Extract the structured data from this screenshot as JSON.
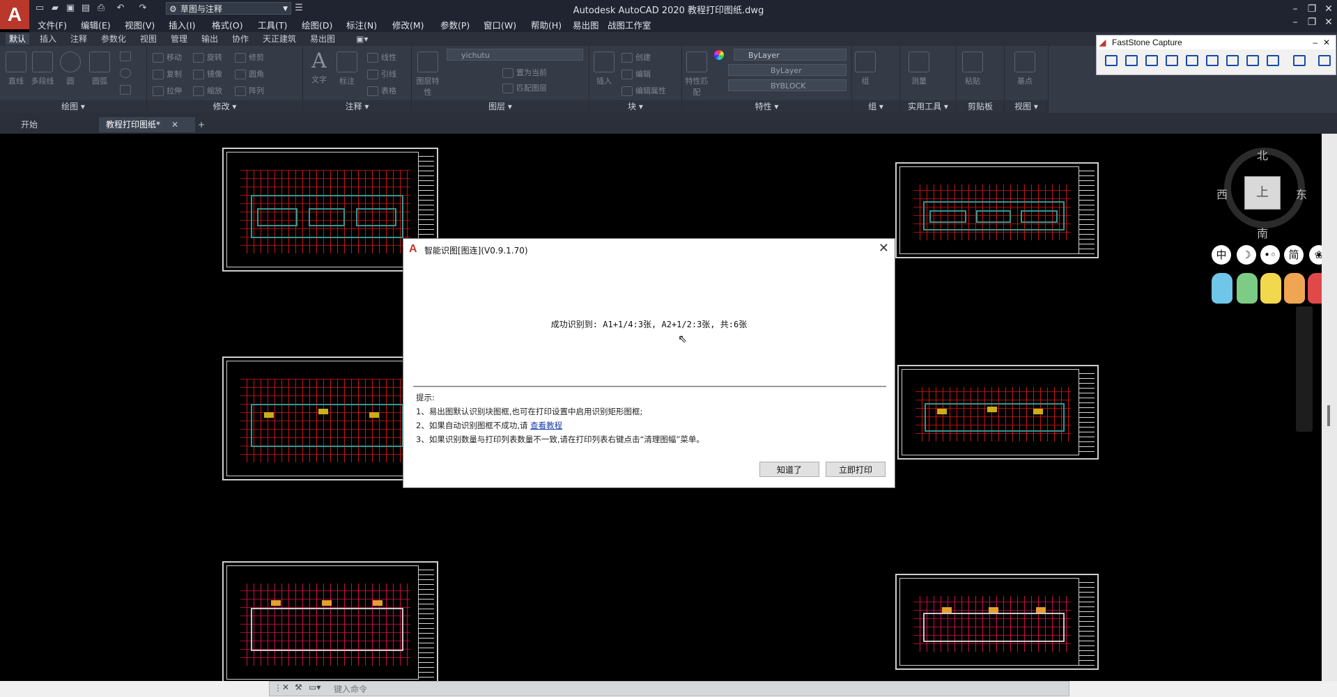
{
  "titlebar": {
    "app_logo": "A",
    "workspace": "草图与注释",
    "window_title": "Autodesk AutoCAD 2020    教程打印图纸.dwg"
  },
  "menu": [
    "文件(F)",
    "编辑(E)",
    "视图(V)",
    "插入(I)",
    "格式(O)",
    "工具(T)",
    "绘图(D)",
    "标注(N)",
    "修改(M)",
    "参数(P)",
    "窗口(W)",
    "帮助(H)",
    "易出图",
    "战图工作室"
  ],
  "ribbon_tabs": [
    "默认",
    "插入",
    "注释",
    "参数化",
    "视图",
    "管理",
    "输出",
    "协作",
    "天正建筑",
    "易出图"
  ],
  "ribbon": {
    "panels": [
      "绘图 ▾",
      "修改 ▾",
      "注释 ▾",
      "图层 ▾",
      "块 ▾",
      "特性 ▾",
      "组 ▾",
      "实用工具 ▾",
      "剪贴板",
      "视图 ▾"
    ],
    "draw_tools": [
      "直线",
      "多段线",
      "圆",
      "圆弧"
    ],
    "modify_tools": [
      "移动",
      "旋转",
      "修剪",
      "复制",
      "镜像",
      "圆角",
      "拉伸",
      "缩放",
      "阵列"
    ],
    "annotate_tools": [
      "文字",
      "标注",
      "线性",
      "引线",
      "表格"
    ],
    "layer_tools": [
      "图层特性",
      "置为当前",
      "匹配图层"
    ],
    "layer_name": "yichutu",
    "block_tools": [
      "插入",
      "创建",
      "编辑",
      "编辑属性"
    ],
    "props": [
      "特性匹配",
      "ByLayer",
      "ByLayer",
      "BYBLOCK"
    ],
    "group_tools": [
      "组"
    ],
    "utility_tools": [
      "测量"
    ],
    "clipboard_tools": [
      "粘贴"
    ],
    "view_tools": [
      "基点"
    ]
  },
  "doc_tabs": {
    "start": "开始",
    "active": "教程打印图纸*",
    "close": "✕",
    "add": "+"
  },
  "viewcube": {
    "north": "北",
    "south": "南",
    "east": "东",
    "west": "西",
    "face": "上"
  },
  "ime": [
    "中",
    "☽",
    "•◦",
    "简",
    "❀"
  ],
  "faststone": {
    "title": "FastStone Capture"
  },
  "dialog": {
    "title": "智能识图[图连](V0.9.1.70)",
    "close": "✕",
    "message": "成功识别到: A1+1/4:3张, A2+1/2:3张, 共:6张",
    "hint_title": "提示:",
    "hint1": "1、易出图默认识别块图框,也可在打印设置中启用识别矩形图框;",
    "hint2_prefix": "2、如果自动识别图框不成功,请",
    "hint2_link": "查看教程",
    "hint3": "3、如果识别数量与打印列表数量不一致,请在打印列表右键点击“清理图幅”菜单。",
    "btn_ok": "知道了",
    "btn_print": "立即打印"
  },
  "command": {
    "placeholder": "键入命令"
  },
  "colors": {
    "plan_red": "#e01818",
    "wall_cyan": "#3aa9a0",
    "accent_yellow": "#e0c31c",
    "app_red": "#b9372b"
  }
}
